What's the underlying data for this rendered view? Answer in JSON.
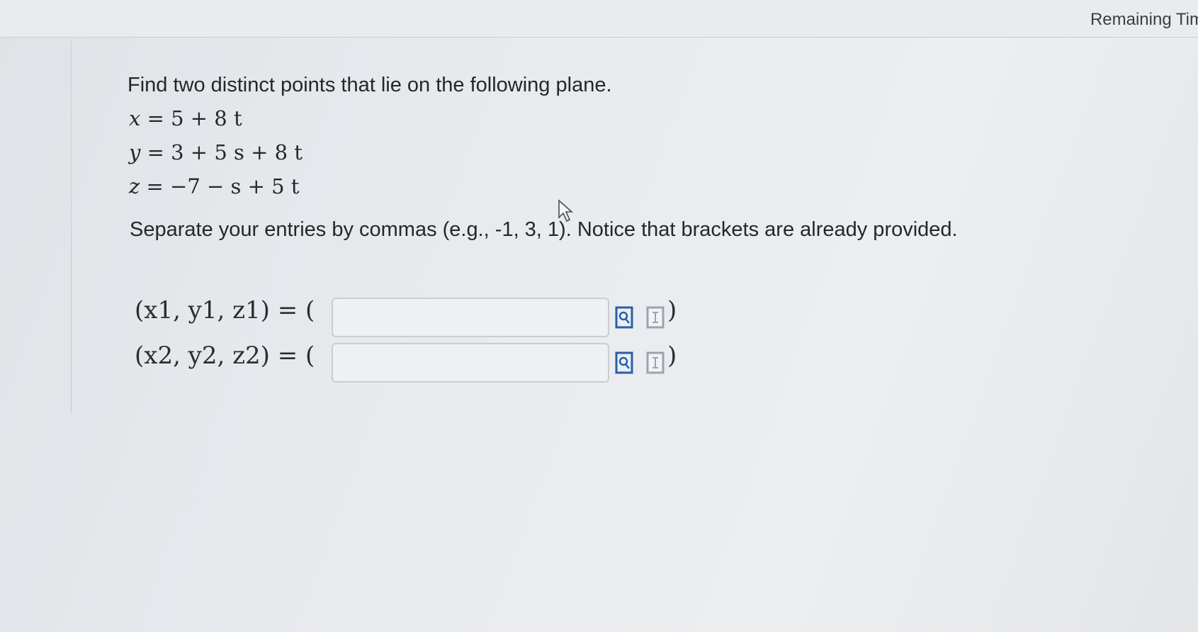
{
  "header": {
    "remaining_time_label": "Remaining Tim"
  },
  "question": {
    "prompt": "Find two distinct points that lie on the following plane.",
    "equations": {
      "x": {
        "lhs": "x",
        "rhs": "= 5 + 8 t"
      },
      "y": {
        "lhs": "y",
        "rhs": "= 3 + 5 s + 8 t"
      },
      "z": {
        "lhs": "z",
        "rhs": "= −7 − s + 5 t"
      }
    },
    "instruction": "Separate your entries by commas (e.g., -1, 3, 1). Notice that brackets are already provided."
  },
  "answers": [
    {
      "label": "(x1, y1, z1) = (",
      "value": "",
      "closing": ")"
    },
    {
      "label": "(x2, y2, z2) = (",
      "value": "",
      "closing": ")"
    }
  ],
  "icons": {
    "preview": "preview-formula-icon",
    "insert": "insert-formula-icon"
  },
  "colors": {
    "icon_blue": "#2b5ea8",
    "icon_gray": "#9aa4b1"
  }
}
